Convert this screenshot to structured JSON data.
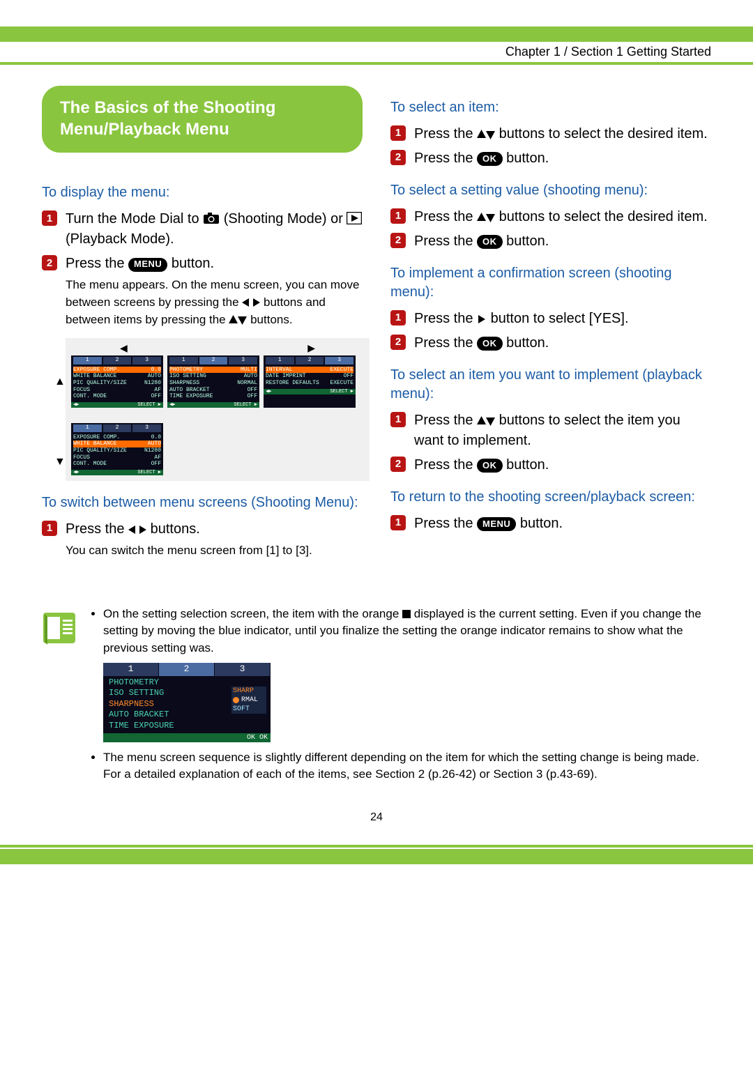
{
  "breadcrumb": "Chapter 1 / Section 1 Getting Started",
  "title": "The Basics of the Shooting Menu/Playback Menu",
  "page_number": "24",
  "left": {
    "h_display": "To display the menu:",
    "s1a": "Turn the Mode Dial to ",
    "s1b": " (Shooting Mode) or ",
    "s1c": " (Playback Mode).",
    "s2a": "Press the ",
    "s2b": " button.",
    "s2_note_a": "The menu appears. On the menu screen, you can move between screens by pressing the ",
    "s2_note_b": " buttons and between items by pressing the ",
    "s2_note_c": " buttons.",
    "h_switch": "To switch between menu screens (Shooting Menu):",
    "sw1a": "Press the ",
    "sw1b": " buttons.",
    "sw1_note": "You can switch the menu screen from [1] to [3]."
  },
  "right": {
    "h_select": "To select an item:",
    "si1a": "Press the ",
    "si1b": " buttons to select the desired item.",
    "si2a": "Press the ",
    "si2b": " button.",
    "h_value": "To select a setting value (shooting menu):",
    "sv1a": "Press the ",
    "sv1b": " buttons to select the desired item.",
    "sv2a": "Press the ",
    "sv2b": " button.",
    "h_confirm": "To implement a confirmation screen (shooting menu):",
    "sc1a": "Press the ",
    "sc1b": " button to select [YES].",
    "sc2a": "Press the ",
    "sc2b": " button.",
    "h_playback": "To select an item you want to implement (playback menu):",
    "sp1a": "Press the ",
    "sp1b": " buttons to select the item you want to implement.",
    "sp2a": "Press the ",
    "sp2b": " button.",
    "h_return": "To return to the shooting screen/playback screen:",
    "sr1a": "Press the ",
    "sr1b": " button."
  },
  "menu_btn": "MENU",
  "ok_btn": "OK",
  "menu_screens": {
    "m1": {
      "tabs": [
        "1",
        "2",
        "3"
      ],
      "rows": [
        [
          "EXPOSURE COMP.",
          "0.0"
        ],
        [
          "WHITE BALANCE",
          "AUTO"
        ],
        [
          "PIC QUALITY/SIZE",
          "N1280"
        ],
        [
          "FOCUS",
          "AF"
        ],
        [
          "CONT. MODE",
          "OFF"
        ]
      ]
    },
    "m2": {
      "tabs": [
        "1",
        "2",
        "3"
      ],
      "rows": [
        [
          "PHOTOMETRY",
          "MULTI"
        ],
        [
          "ISO SETTING",
          "AUTO"
        ],
        [
          "SHARPNESS",
          "NORMAL"
        ],
        [
          "AUTO BRACKET",
          "OFF"
        ],
        [
          "TIME EXPOSURE",
          "OFF"
        ]
      ]
    },
    "m3": {
      "tabs": [
        "1",
        "2",
        "3"
      ],
      "rows": [
        [
          "INTERVAL",
          "EXECUTE"
        ],
        [
          "DATE IMPRINT",
          "OFF"
        ],
        [
          "RESTORE DEFAULTS",
          "EXECUTE"
        ]
      ]
    },
    "m1b": {
      "tabs": [
        "1",
        "2",
        "3"
      ],
      "rows": [
        [
          "EXPOSURE COMP.",
          "0.0"
        ],
        [
          "WHITE BALANCE",
          "AUTO"
        ],
        [
          "PIC QUALITY/SIZE",
          "N1280"
        ],
        [
          "FOCUS",
          "AF"
        ],
        [
          "CONT. MODE",
          "OFF"
        ]
      ]
    }
  },
  "note": {
    "b1a": "On the setting selection screen, the item with the orange ",
    "b1b": " displayed is the current setting. Even if you change the setting by moving the blue indicator, until you finalize the setting the orange indicator remains to show what the previous setting was.",
    "b2": "The menu screen sequence is slightly different depending on the item for which the setting change is being made. For a detailed explanation of each of the items, see Section 2 (p.26-42) or Section 3 (p.43-69).",
    "shot": {
      "tabs": [
        "1",
        "2",
        "3"
      ],
      "rows": [
        "PHOTOMETRY",
        "ISO SETTING",
        "SHARPNESS",
        "AUTO BRACKET",
        "TIME EXPOSURE"
      ],
      "popup": [
        "SHARP",
        "RMAL",
        "SOFT"
      ],
      "foot": "OK OK"
    }
  }
}
